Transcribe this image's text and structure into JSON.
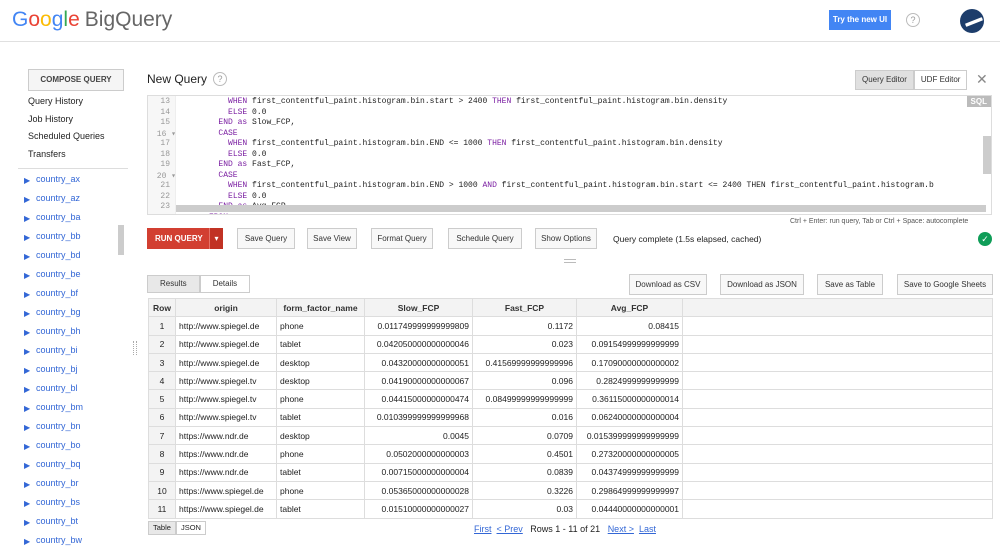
{
  "header": {
    "logo_google": [
      "G",
      "o",
      "o",
      "g",
      "l",
      "e"
    ],
    "logo_product": "BigQuery",
    "try_new_ui": "Try the new UI",
    "help": "?"
  },
  "sidebar": {
    "compose_label": "COMPOSE QUERY",
    "nav": [
      "Query History",
      "Job History",
      "Scheduled Queries",
      "Transfers"
    ],
    "datasets": [
      "country_ax",
      "country_az",
      "country_ba",
      "country_bb",
      "country_bd",
      "country_be",
      "country_bf",
      "country_bg",
      "country_bh",
      "country_bi",
      "country_bj",
      "country_bl",
      "country_bm",
      "country_bn",
      "country_bo",
      "country_bq",
      "country_br",
      "country_bs",
      "country_bt",
      "country_bw"
    ]
  },
  "query": {
    "title": "New Query",
    "help": "?",
    "tabs": [
      "Query Editor",
      "UDF Editor"
    ],
    "close": "✕",
    "sql_badge": "SQL",
    "lines": [
      {
        "n": "13",
        "fold": false,
        "indent": "          ",
        "kw": "WHEN",
        "rest": " first_contentful_paint.histogram.bin.start > 2400 ",
        "kw2": "THEN",
        "rest2": " first_contentful_paint.histogram.bin.density"
      },
      {
        "n": "14",
        "fold": false,
        "indent": "          ",
        "kw": "ELSE",
        "rest": " 0.0",
        "kw2": "",
        "rest2": ""
      },
      {
        "n": "15",
        "fold": false,
        "indent": "        ",
        "kw": "END",
        "rest": " ",
        "kw2": "as",
        "rest2": " Slow_FCP,"
      },
      {
        "n": "16",
        "fold": true,
        "indent": "        ",
        "kw": "CASE",
        "rest": "",
        "kw2": "",
        "rest2": ""
      },
      {
        "n": "17",
        "fold": false,
        "indent": "          ",
        "kw": "WHEN",
        "rest": " first_contentful_paint.histogram.bin.END <= 1000 ",
        "kw2": "THEN",
        "rest2": " first_contentful_paint.histogram.bin.density"
      },
      {
        "n": "18",
        "fold": false,
        "indent": "          ",
        "kw": "ELSE",
        "rest": " 0.0",
        "kw2": "",
        "rest2": ""
      },
      {
        "n": "19",
        "fold": false,
        "indent": "        ",
        "kw": "END",
        "rest": " ",
        "kw2": "as",
        "rest2": " Fast_FCP,"
      },
      {
        "n": "20",
        "fold": true,
        "indent": "        ",
        "kw": "CASE",
        "rest": "",
        "kw2": "",
        "rest2": ""
      },
      {
        "n": "21",
        "fold": false,
        "indent": "          ",
        "kw": "WHEN",
        "rest": " first_contentful_paint.histogram.bin.END > 1000 ",
        "kw2": "AND",
        "rest2": " first_contentful_paint.histogram.bin.start <= 2400 THEN first_contentful_paint.histogram.b"
      },
      {
        "n": "22",
        "fold": false,
        "indent": "          ",
        "kw": "ELSE",
        "rest": " 0.0",
        "kw2": "",
        "rest2": ""
      },
      {
        "n": "23",
        "fold": false,
        "indent": "        ",
        "kw": "END",
        "rest": " ",
        "kw2": "as",
        "rest2": " Avg_FCP,"
      },
      {
        "n": "",
        "fold": false,
        "indent": "      ",
        "kw": "FROM",
        "rest": "",
        "kw2": "",
        "rest2": ""
      }
    ],
    "hint": "Ctrl + Enter: run query, Tab or Ctrl + Space: autocomplete",
    "run_label": "RUN QUERY",
    "run_drop": "▾",
    "buttons": [
      "Save Query",
      "Save View",
      "Format Query",
      "Schedule Query",
      "Show Options"
    ],
    "status": "Query complete (1.5s elapsed, cached)",
    "status_icon": "✓",
    "status_color": "#0f9d58"
  },
  "results": {
    "tabs": [
      "Results",
      "Details"
    ],
    "actions": [
      "Download as CSV",
      "Download as JSON",
      "Save as Table",
      "Save to Google Sheets"
    ],
    "columns": [
      "Row",
      "origin",
      "form_factor_name",
      "Slow_FCP",
      "Fast_FCP",
      "Avg_FCP"
    ],
    "rows": [
      [
        "1",
        "http://www.spiegel.de",
        "phone",
        "0.011749999999999809",
        "0.1172",
        "0.08415"
      ],
      [
        "2",
        "http://www.spiegel.de",
        "tablet",
        "0.042050000000000046",
        "0.023",
        "0.09154999999999999"
      ],
      [
        "3",
        "http://www.spiegel.de",
        "desktop",
        "0.04320000000000051",
        "0.41569999999999996",
        "0.17090000000000002"
      ],
      [
        "4",
        "http://www.spiegel.tv",
        "desktop",
        "0.04190000000000067",
        "0.096",
        "0.2824999999999999"
      ],
      [
        "5",
        "http://www.spiegel.tv",
        "phone",
        "0.04415000000000474",
        "0.08499999999999999",
        "0.36115000000000014"
      ],
      [
        "6",
        "http://www.spiegel.tv",
        "tablet",
        "0.010399999999999968",
        "0.016",
        "0.06240000000000004"
      ],
      [
        "7",
        "https://www.ndr.de",
        "desktop",
        "0.0045",
        "0.0709",
        "0.015399999999999999"
      ],
      [
        "8",
        "https://www.ndr.de",
        "phone",
        "0.0502000000000003",
        "0.4501",
        "0.27320000000000005"
      ],
      [
        "9",
        "https://www.ndr.de",
        "tablet",
        "0.00715000000000004",
        "0.0839",
        "0.04374999999999999"
      ],
      [
        "10",
        "https://www.spiegel.de",
        "phone",
        "0.05365000000000028",
        "0.3226",
        "0.29864999999999997"
      ],
      [
        "11",
        "https://www.spiegel.de",
        "tablet",
        "0.01510000000000027",
        "0.03",
        "0.04440000000000001"
      ]
    ],
    "view_tabs": [
      "Table",
      "JSON"
    ],
    "pager": {
      "first": "First",
      "prev": "< Prev",
      "info": "Rows 1 - 11 of 21",
      "next": "Next >",
      "last": "Last"
    }
  }
}
